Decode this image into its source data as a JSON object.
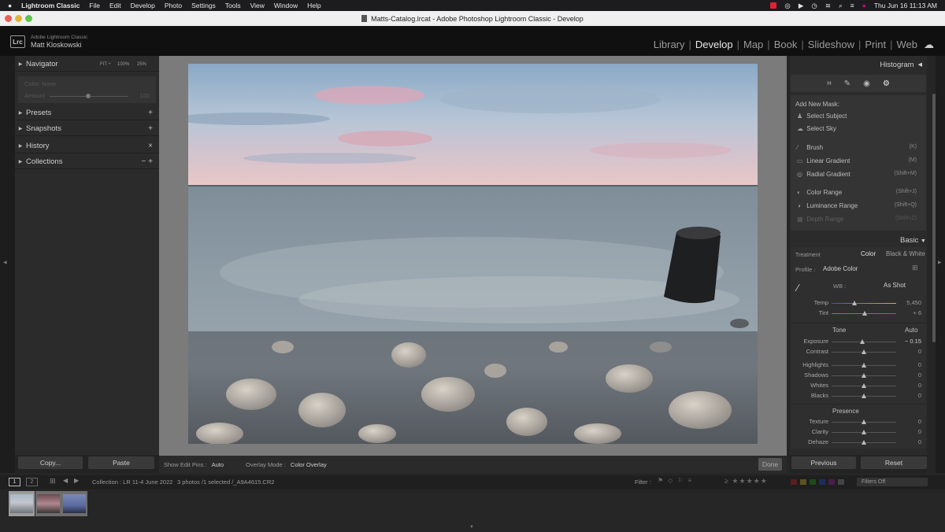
{
  "menubar": {
    "app": "Lightroom Classic",
    "items": [
      "File",
      "Edit",
      "Develop",
      "Photo",
      "Settings",
      "Tools",
      "View",
      "Window",
      "Help"
    ],
    "clock": "Thu Jun 16  11:13 AM"
  },
  "window": {
    "title": "Matts-Catalog.lrcat - Adobe Photoshop Lightroom Classic - Develop"
  },
  "identity": {
    "badge": "Lrc",
    "product": "Adobe Lightroom Classic",
    "user": "Matt Kloskowski",
    "modules": [
      "Library",
      "Develop",
      "Map",
      "Book",
      "Slideshow",
      "Print",
      "Web"
    ],
    "active": "Develop"
  },
  "left": {
    "navigator": {
      "label": "Navigator",
      "zoom": [
        "FIT ÷",
        "100%",
        "25%"
      ]
    },
    "preview_lines": [
      "Color: None",
      "Amount"
    ],
    "preview_value": "100",
    "panels": [
      {
        "label": "Presets",
        "act": "+"
      },
      {
        "label": "Snapshots",
        "act": "+"
      },
      {
        "label": "History",
        "act": "×"
      },
      {
        "label": "Collections",
        "act": "− +"
      }
    ],
    "copy": "Copy...",
    "paste": "Paste"
  },
  "right": {
    "histogram": "Histogram",
    "add_mask": "Add New Mask:",
    "masks": [
      {
        "label": "Select Subject",
        "key": ""
      },
      {
        "label": "Select Sky",
        "key": ""
      },
      {
        "label": "Brush",
        "key": "(K)"
      },
      {
        "label": "Linear Gradient",
        "key": "(M)"
      },
      {
        "label": "Radial Gradient",
        "key": "(Shift+M)"
      },
      {
        "label": "Color Range",
        "key": "(Shift+J)"
      },
      {
        "label": "Luminance Range",
        "key": "(Shift+Q)"
      },
      {
        "label": "Depth Range",
        "key": "(Shift+Z)"
      }
    ],
    "basic": "Basic",
    "treatment": "Treatment",
    "color": "Color",
    "bw": "Black & White",
    "profile_label": "Profile :",
    "profile": "Adobe Color",
    "wb_label": "WB :",
    "wb": "As Shot",
    "temp": {
      "label": "Temp",
      "value": "5,450"
    },
    "tint": {
      "label": "Tint",
      "value": "+ 6"
    },
    "tone": "Tone",
    "auto": "Auto",
    "tone_sliders": [
      {
        "label": "Exposure",
        "value": "− 0.15"
      },
      {
        "label": "Contrast",
        "value": "0"
      },
      {
        "label": "Highlights",
        "value": "0"
      },
      {
        "label": "Shadows",
        "value": "0"
      },
      {
        "label": "Whites",
        "value": "0"
      },
      {
        "label": "Blacks",
        "value": "0"
      }
    ],
    "presence": "Presence",
    "presence_sliders": [
      {
        "label": "Texture",
        "value": "0"
      },
      {
        "label": "Clarity",
        "value": "0"
      },
      {
        "label": "Dehaze",
        "value": "0"
      }
    ],
    "previous": "Previous",
    "reset": "Reset"
  },
  "toolbar": {
    "pins_label": "Show Edit Pins :",
    "pins": "Auto",
    "overlay_label": "Overlay Mode :",
    "overlay": "Color Overlay",
    "done": "Done"
  },
  "filmbar": {
    "view1": "1",
    "view2": "2",
    "collection": "Collection : LR 11-4 June 2022",
    "count": "3 photos /1 selected /_A9A4615.CR2",
    "filter_label": "Filter :",
    "filters": "Filters Off"
  }
}
